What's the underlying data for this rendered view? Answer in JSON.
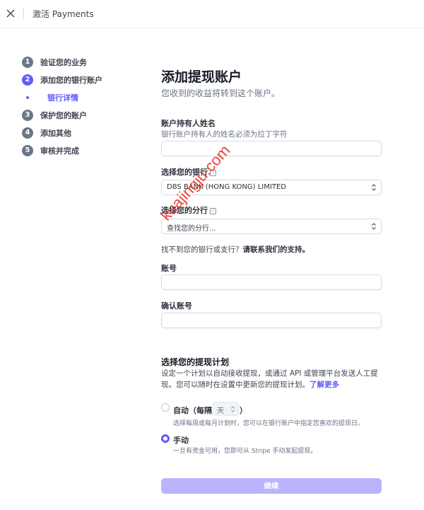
{
  "topbar": {
    "title": "激活 Payments"
  },
  "steps": [
    {
      "num": "1",
      "label": "验证您的业务"
    },
    {
      "num": "2",
      "label": "添加您的银行账户"
    },
    {
      "num": "3",
      "label": "保护您的账户"
    },
    {
      "num": "4",
      "label": "添加其他"
    },
    {
      "num": "5",
      "label": "审核并完成"
    }
  ],
  "substep": {
    "label": "银行详情"
  },
  "form": {
    "title": "添加提现账户",
    "subtitle": "您收到的收益将转到这个账户。",
    "holder": {
      "label": "账户持有人姓名",
      "hint": "银行账户持有人的姓名必须为拉丁字符",
      "value": ""
    },
    "bank": {
      "label": "选择您的银行",
      "value": "DBS BANK (HONG KONG) LIMITED"
    },
    "branch": {
      "label": "选择您的分行",
      "placeholder": "查找您的分行..."
    },
    "nobank": {
      "text": "找不到您的银行或支行？",
      "link": "请联系我们的支持。"
    },
    "account": {
      "label": "账号",
      "value": ""
    },
    "confirm": {
      "label": "确认账号",
      "value": ""
    }
  },
  "payout": {
    "title": "选择您的提现计划",
    "desc": "设定一个计划以自动接收提现，或通过 API 或管理平台发送人工提现。您可以随时在设置中更新您的提现计划。",
    "learn_more": "了解更多",
    "auto": {
      "label_pre": "自动（每隔",
      "interval": "天",
      "label_post": "）",
      "hint": "选择每周或每月计划时，您可以在银行账户中指定您喜欢的提现日。"
    },
    "manual": {
      "label": "手动",
      "hint": "一旦有资金可用，您即可从 Stripe 手动发起提现。"
    }
  },
  "continue_label": "继续",
  "watermark": "kuajingju.com",
  "colors": {
    "accent": "#635bff",
    "continue_disabled": "#b9b4fb"
  }
}
